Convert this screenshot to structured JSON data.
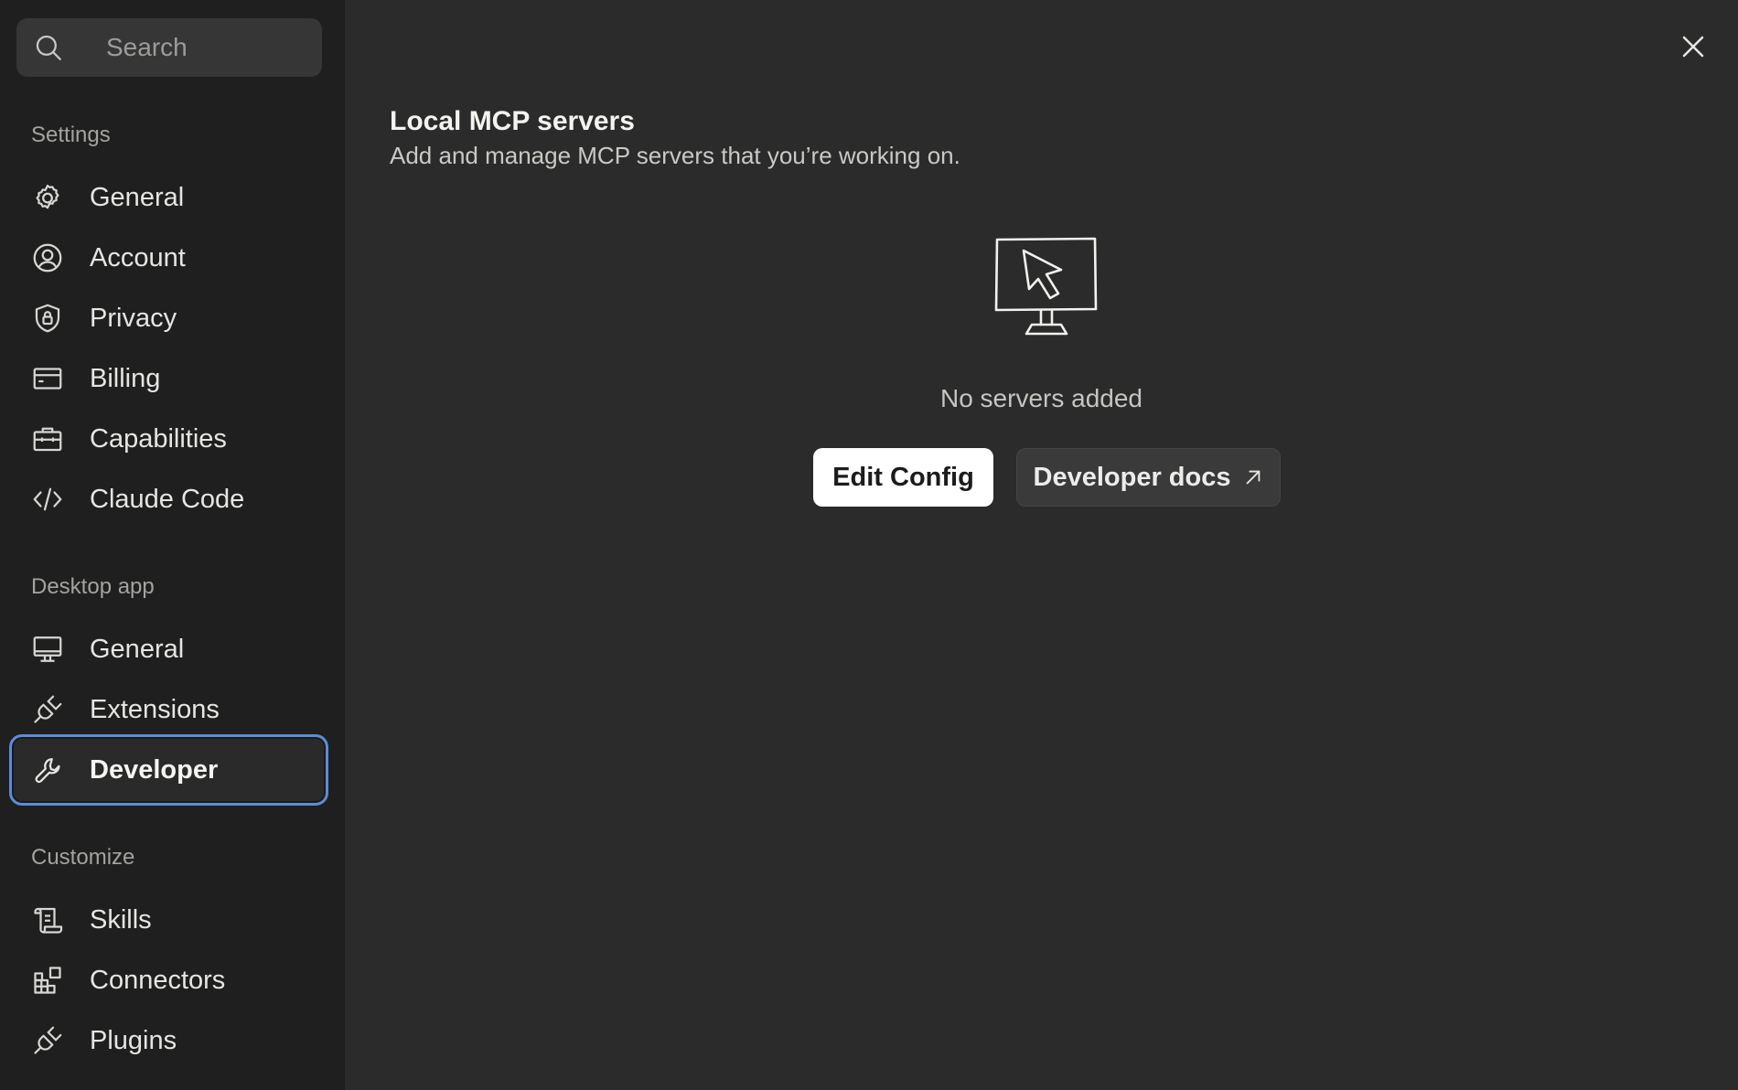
{
  "search": {
    "placeholder": "Search"
  },
  "sidebar": {
    "sections": [
      {
        "label": "Settings",
        "items": [
          {
            "label": "General",
            "icon": "gear-icon"
          },
          {
            "label": "Account",
            "icon": "user-circle-icon"
          },
          {
            "label": "Privacy",
            "icon": "shield-lock-icon"
          },
          {
            "label": "Billing",
            "icon": "credit-card-icon"
          },
          {
            "label": "Capabilities",
            "icon": "briefcase-icon"
          },
          {
            "label": "Claude Code",
            "icon": "code-icon"
          }
        ]
      },
      {
        "label": "Desktop app",
        "items": [
          {
            "label": "General",
            "icon": "monitor-icon"
          },
          {
            "label": "Extensions",
            "icon": "plug-icon"
          },
          {
            "label": "Developer",
            "icon": "wrench-icon",
            "active": true
          }
        ]
      },
      {
        "label": "Customize",
        "items": [
          {
            "label": "Skills",
            "icon": "scroll-icon"
          },
          {
            "label": "Connectors",
            "icon": "blocks-icon"
          },
          {
            "label": "Plugins",
            "icon": "plug-icon"
          }
        ]
      }
    ]
  },
  "main": {
    "title": "Local MCP servers",
    "subtitle": "Add and manage MCP servers that you’re working on.",
    "empty_text": "No servers added",
    "edit_config_label": "Edit Config",
    "developer_docs_label": "Developer docs"
  },
  "colors": {
    "sidebar_bg": "#1f1f1f",
    "main_bg": "#2b2b2b",
    "active_outline": "#5b8dd6",
    "primary_button_bg": "#ffffff"
  }
}
